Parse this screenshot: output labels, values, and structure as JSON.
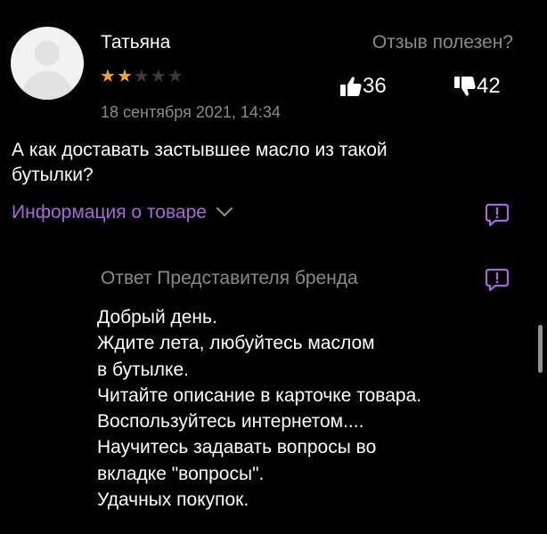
{
  "review": {
    "author": "Татьяна",
    "rating": 2,
    "rating_max": 5,
    "date": "18 сентября 2021, 14:34",
    "helpful_question": "Отзыв полезен?",
    "likes": "36",
    "dislikes": "42",
    "text": "А как доставать застывшее масло из такой бутылки?",
    "product_info_label": "Информация о товаре"
  },
  "brand_reply": {
    "title": "Ответ Представителя бренда",
    "text": "Добрый день.\nЖдите лета, любуйтесь маслом\nв бутылке.\nЧитайте описание в карточке товара.\nВоспользуйтесь интернетом....\nНаучитесь задавать вопросы во\nвкладке \"вопросы\".\nУдачных покупок."
  },
  "colors": {
    "background": "#000000",
    "accent": "#a46bd8",
    "star_filled": "#f0a62d",
    "star_empty": "#3a3a3a",
    "muted_text": "#8a8a8e"
  },
  "icons": {
    "like": "thumbs-up-icon",
    "dislike": "thumbs-down-icon",
    "expand": "chevron-down-icon",
    "report": "report-icon"
  }
}
